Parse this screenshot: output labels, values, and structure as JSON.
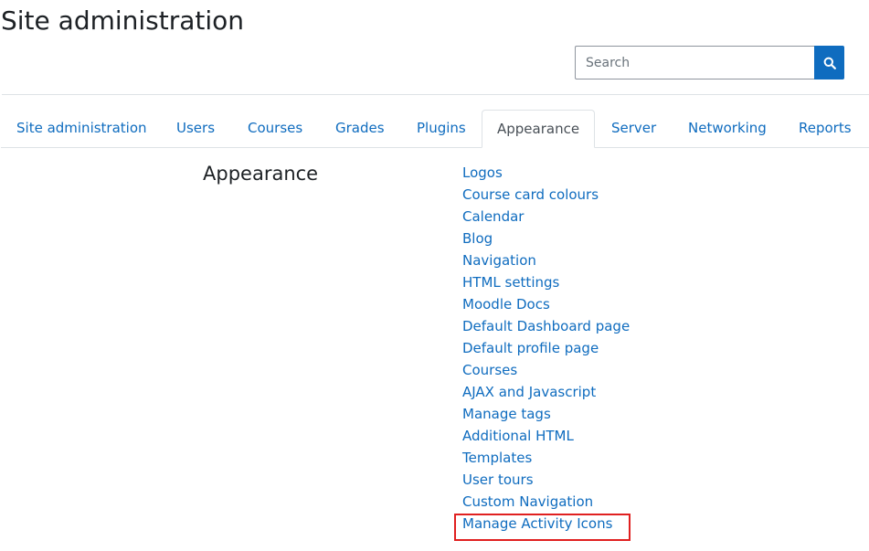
{
  "page": {
    "title": "Site administration"
  },
  "search": {
    "placeholder": "Search",
    "value": "",
    "icon": "search-icon"
  },
  "tabs": [
    {
      "label": "Site administration",
      "active": false
    },
    {
      "label": "Users",
      "active": false
    },
    {
      "label": "Courses",
      "active": false
    },
    {
      "label": "Grades",
      "active": false
    },
    {
      "label": "Plugins",
      "active": false
    },
    {
      "label": "Appearance",
      "active": true
    },
    {
      "label": "Server",
      "active": false
    },
    {
      "label": "Networking",
      "active": false
    },
    {
      "label": "Reports",
      "active": false
    }
  ],
  "section": {
    "heading": "Appearance",
    "links": [
      "Logos",
      "Course card colours",
      "Calendar",
      "Blog",
      "Navigation",
      "HTML settings",
      "Moodle Docs",
      "Default Dashboard page",
      "Default profile page",
      "Courses",
      "AJAX and Javascript",
      "Manage tags",
      "Additional HTML",
      "Templates",
      "User tours",
      "Custom Navigation",
      "Manage Activity Icons"
    ]
  },
  "colors": {
    "link": "#0f6cbf",
    "highlight": "#e02020"
  }
}
